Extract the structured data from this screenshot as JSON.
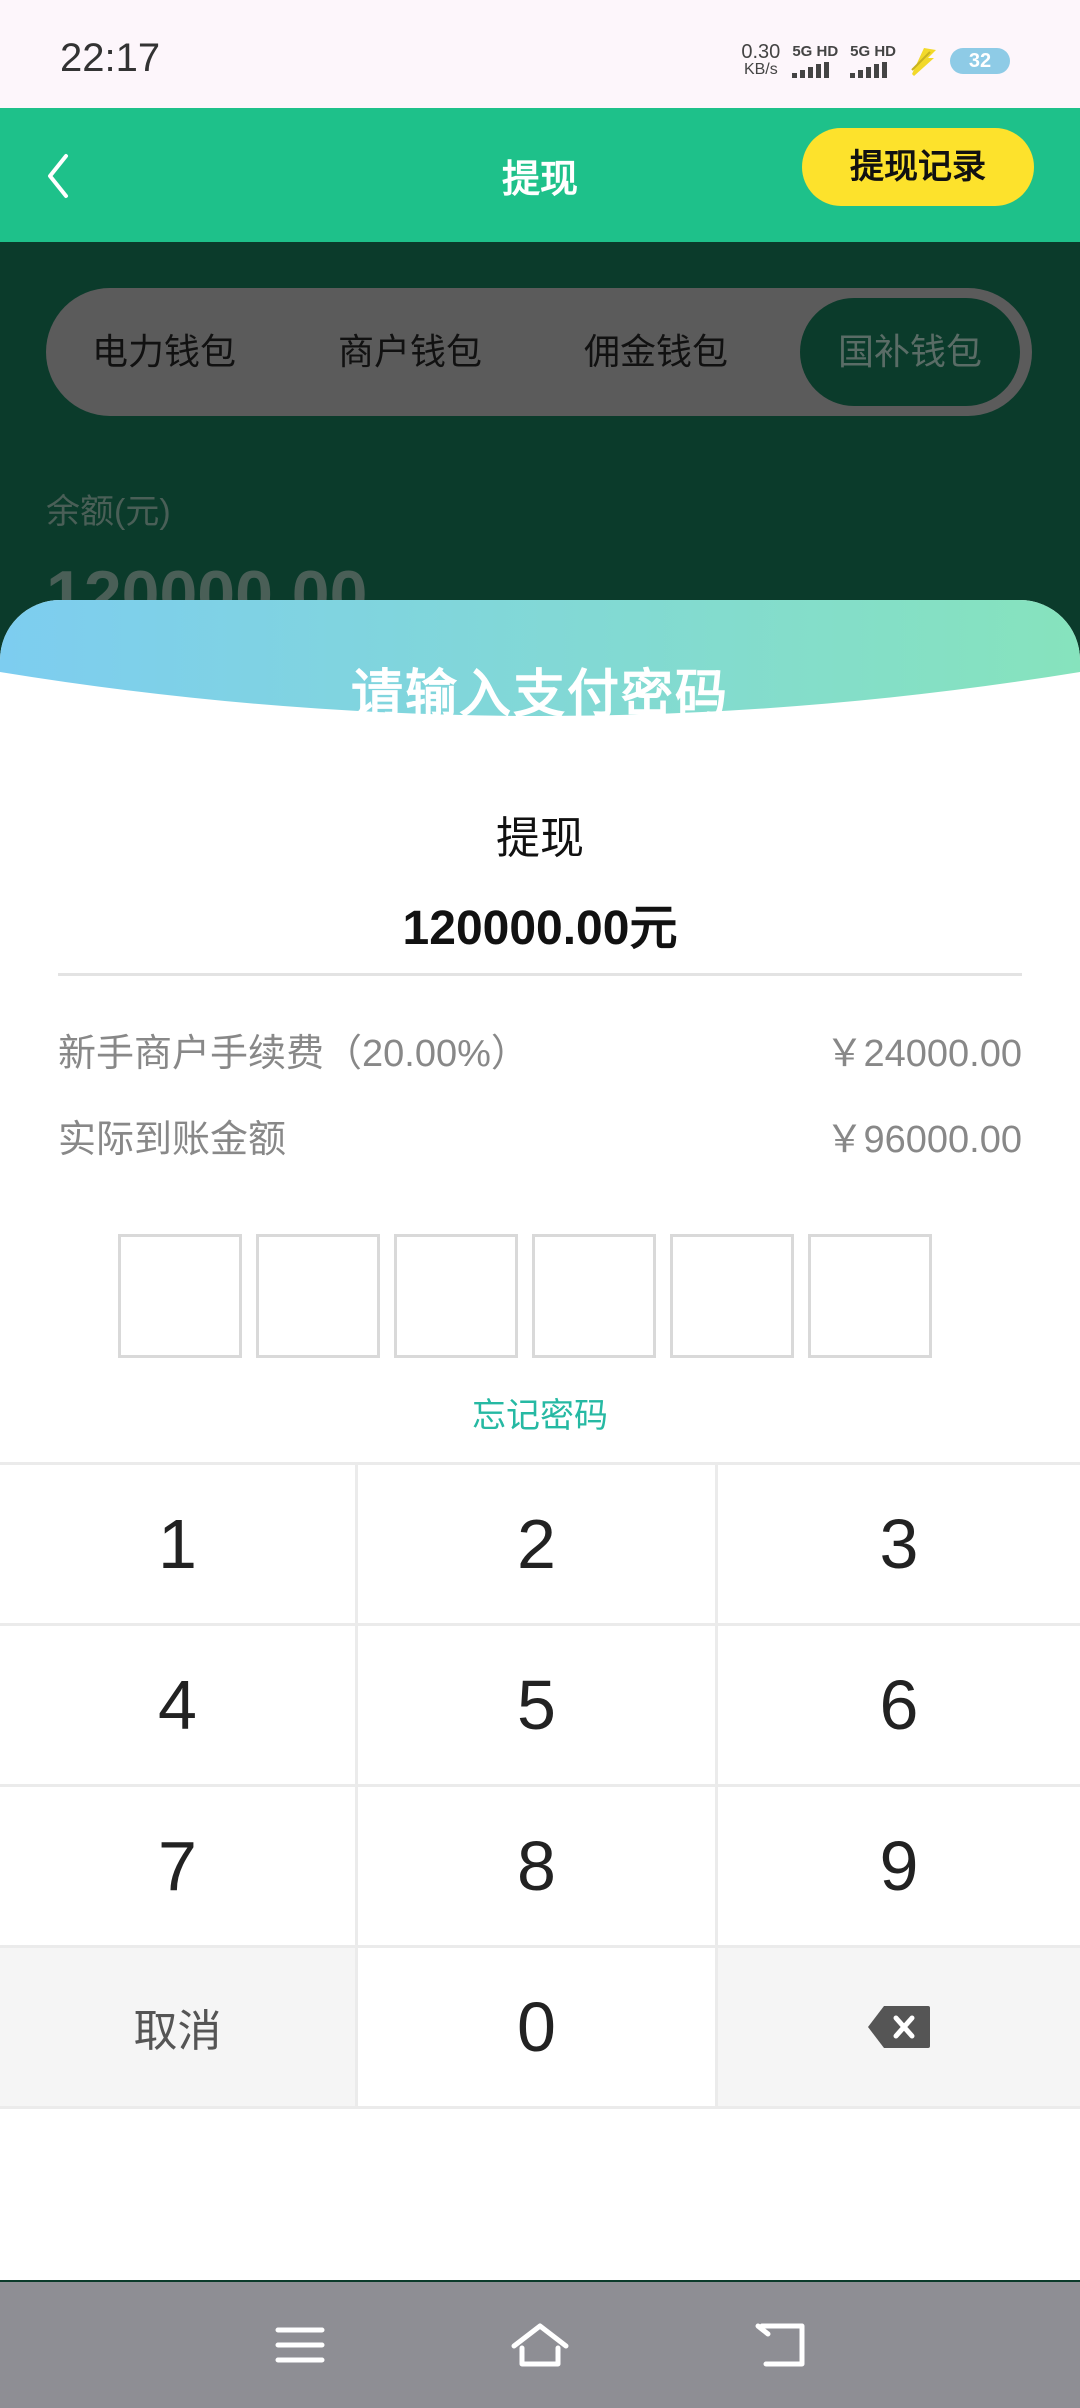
{
  "status_bar": {
    "time": "22:17",
    "net_speed_value": "0.30",
    "net_speed_unit": "KB/s",
    "sim1_label": "5G HD",
    "sim2_label": "5G HD",
    "battery_level": "32"
  },
  "header": {
    "title": "提现",
    "record_button": "提现记录"
  },
  "wallet_tabs": [
    {
      "label": "电力钱包",
      "active": false
    },
    {
      "label": "商户钱包",
      "active": false
    },
    {
      "label": "佣金钱包",
      "active": false
    },
    {
      "label": "国补钱包",
      "active": true
    }
  ],
  "balance": {
    "label": "余额(元)",
    "value": "120000.00"
  },
  "password_sheet": {
    "title": "请输入支付密码",
    "operation": "提现",
    "amount": "120000.00元",
    "fee_label": "新手商户手续费（20.00%）",
    "fee_value": "￥24000.00",
    "actual_label": "实际到账金额",
    "actual_value": "￥96000.00",
    "pin_length": 6,
    "forgot_password": "忘记密码"
  },
  "keypad": {
    "keys": [
      "1",
      "2",
      "3",
      "4",
      "5",
      "6",
      "7",
      "8",
      "9"
    ],
    "cancel": "取消",
    "zero": "0",
    "delete_icon": "backspace-icon"
  },
  "colors": {
    "header_green": "#1ec18a",
    "record_yellow": "#fde22c",
    "link_teal": "#26b9a3",
    "overlay_dark": "#0b3b2b"
  }
}
